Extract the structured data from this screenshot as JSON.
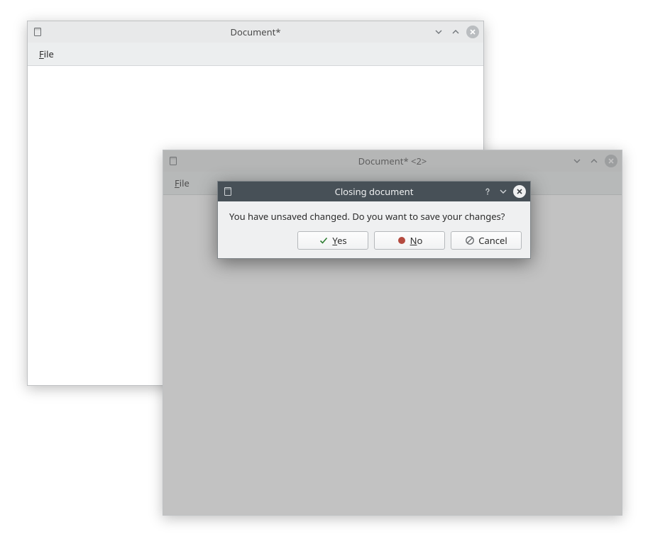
{
  "window1": {
    "title": "Document*",
    "menu": {
      "file": "File",
      "file_mnemonic": "F"
    }
  },
  "window2": {
    "title": "Document* <2>",
    "menu": {
      "file": "File",
      "file_mnemonic": "F"
    }
  },
  "dialog": {
    "title": "Closing document",
    "message": "You have unsaved changed. Do you want to save your changes?",
    "buttons": {
      "yes": "Yes",
      "yes_mnemonic": "Y",
      "no": "No",
      "no_mnemonic": "N",
      "cancel": "Cancel"
    }
  }
}
